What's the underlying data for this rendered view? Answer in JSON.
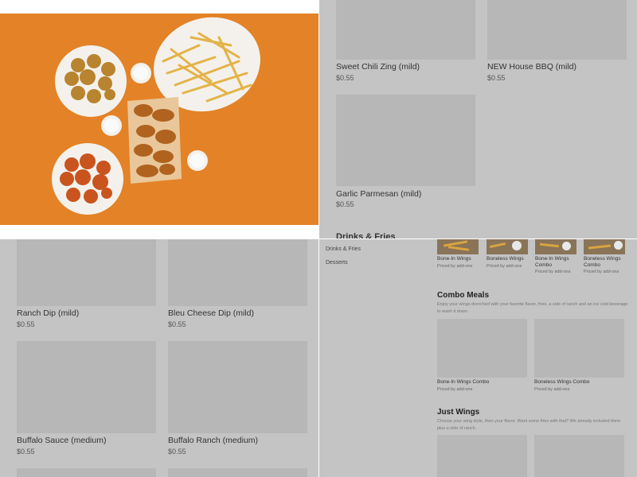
{
  "panel_top_left": {
    "hero_image": "wings-fries-platter-photo"
  },
  "panel_top_right": {
    "items": [
      {
        "name": "Sweet Chili Zing (mild)",
        "price": "$0.55"
      },
      {
        "name": "NEW House BBQ (mild)",
        "price": "$0.55"
      },
      {
        "name": "Garlic Parmesan (mild)",
        "price": "$0.55"
      }
    ],
    "cut_heading": "Drinks & Fries"
  },
  "panel_bottom_left": {
    "items": [
      {
        "name": "Ranch Dip (mild)",
        "price": "$0.55"
      },
      {
        "name": "Bleu Cheese Dip (mild)",
        "price": "$0.55"
      },
      {
        "name": "Buffalo Sauce (medium)",
        "price": "$0.55"
      },
      {
        "name": "Buffalo Ranch (medium)",
        "price": "$0.55"
      }
    ]
  },
  "panel_bottom_right": {
    "nav": [
      "Drinks & Fries",
      "Desserts"
    ],
    "top_items": [
      {
        "name": "Bone-In Wings",
        "price": "Priced by add-ons"
      },
      {
        "name": "Boneless Wings",
        "price": "Priced by add-ons"
      },
      {
        "name": "Bone-In Wings Combo",
        "price": "Priced by add-ons"
      },
      {
        "name": "Boneless Wings Combo",
        "price": "Priced by add-ons"
      }
    ],
    "combo": {
      "title": "Combo Meals",
      "description": "Enjoy your wings drenched with your favorite flavor, fries, a side of ranch and an ice cold beverage to wash it down.",
      "items": [
        {
          "name": "Bone-In Wings Combo",
          "price": "Priced by add-ons"
        },
        {
          "name": "Boneless Wings Combo",
          "price": "Priced by add-ons"
        }
      ]
    },
    "just_wings": {
      "title": "Just Wings",
      "description": "Choose your wing style, then your flavor. Want some fries with that? We already included them plus a side of ranch."
    }
  },
  "colors": {
    "overlay_gray": "#c4c4c4",
    "thumb_gray": "#b7b7b7",
    "photo_orange": "#e8862a"
  }
}
